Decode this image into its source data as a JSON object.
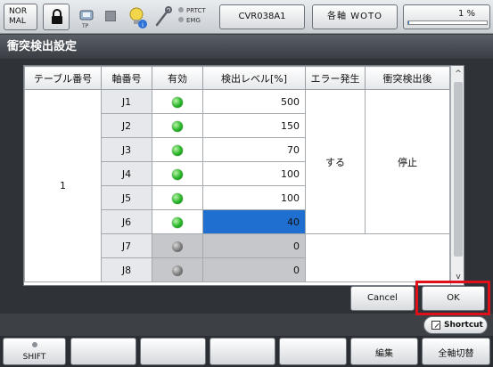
{
  "topbar": {
    "mode": "NOR\nMAL",
    "tp_label": "TP",
    "prtct_label": "PRTCT",
    "emg_label": "EMG",
    "program": "CVR038A1",
    "axis_mode": "各軸 WOTO",
    "speed_text": "1 %",
    "speed_percent": 1
  },
  "title": "衝突検出設定",
  "table": {
    "headers": [
      "テーブル番号",
      "軸番号",
      "有効",
      "検出レベル[%]",
      "エラー発生",
      "衝突検出後"
    ],
    "table_number": "1",
    "error_occurrence": "する",
    "after_detection": "停止",
    "rows": [
      {
        "axis": "J1",
        "enabled": true,
        "level": "500"
      },
      {
        "axis": "J2",
        "enabled": true,
        "level": "150"
      },
      {
        "axis": "J3",
        "enabled": true,
        "level": "70"
      },
      {
        "axis": "J4",
        "enabled": true,
        "level": "100"
      },
      {
        "axis": "J5",
        "enabled": true,
        "level": "100"
      },
      {
        "axis": "J6",
        "enabled": true,
        "level": "40",
        "selected": true
      },
      {
        "axis": "J7",
        "enabled": false,
        "level": "0"
      },
      {
        "axis": "J8",
        "enabled": false,
        "level": "0"
      }
    ]
  },
  "buttons": {
    "cancel": "Cancel",
    "ok": "OK",
    "shortcut": "Shortcut"
  },
  "function_keys": [
    "SHIFT",
    "",
    "",
    "",
    "",
    "編集",
    "全軸切替"
  ],
  "colors": {
    "selection": "#1e6fd0",
    "ok_highlight": "#e0101b",
    "led_on": "#26b327"
  }
}
